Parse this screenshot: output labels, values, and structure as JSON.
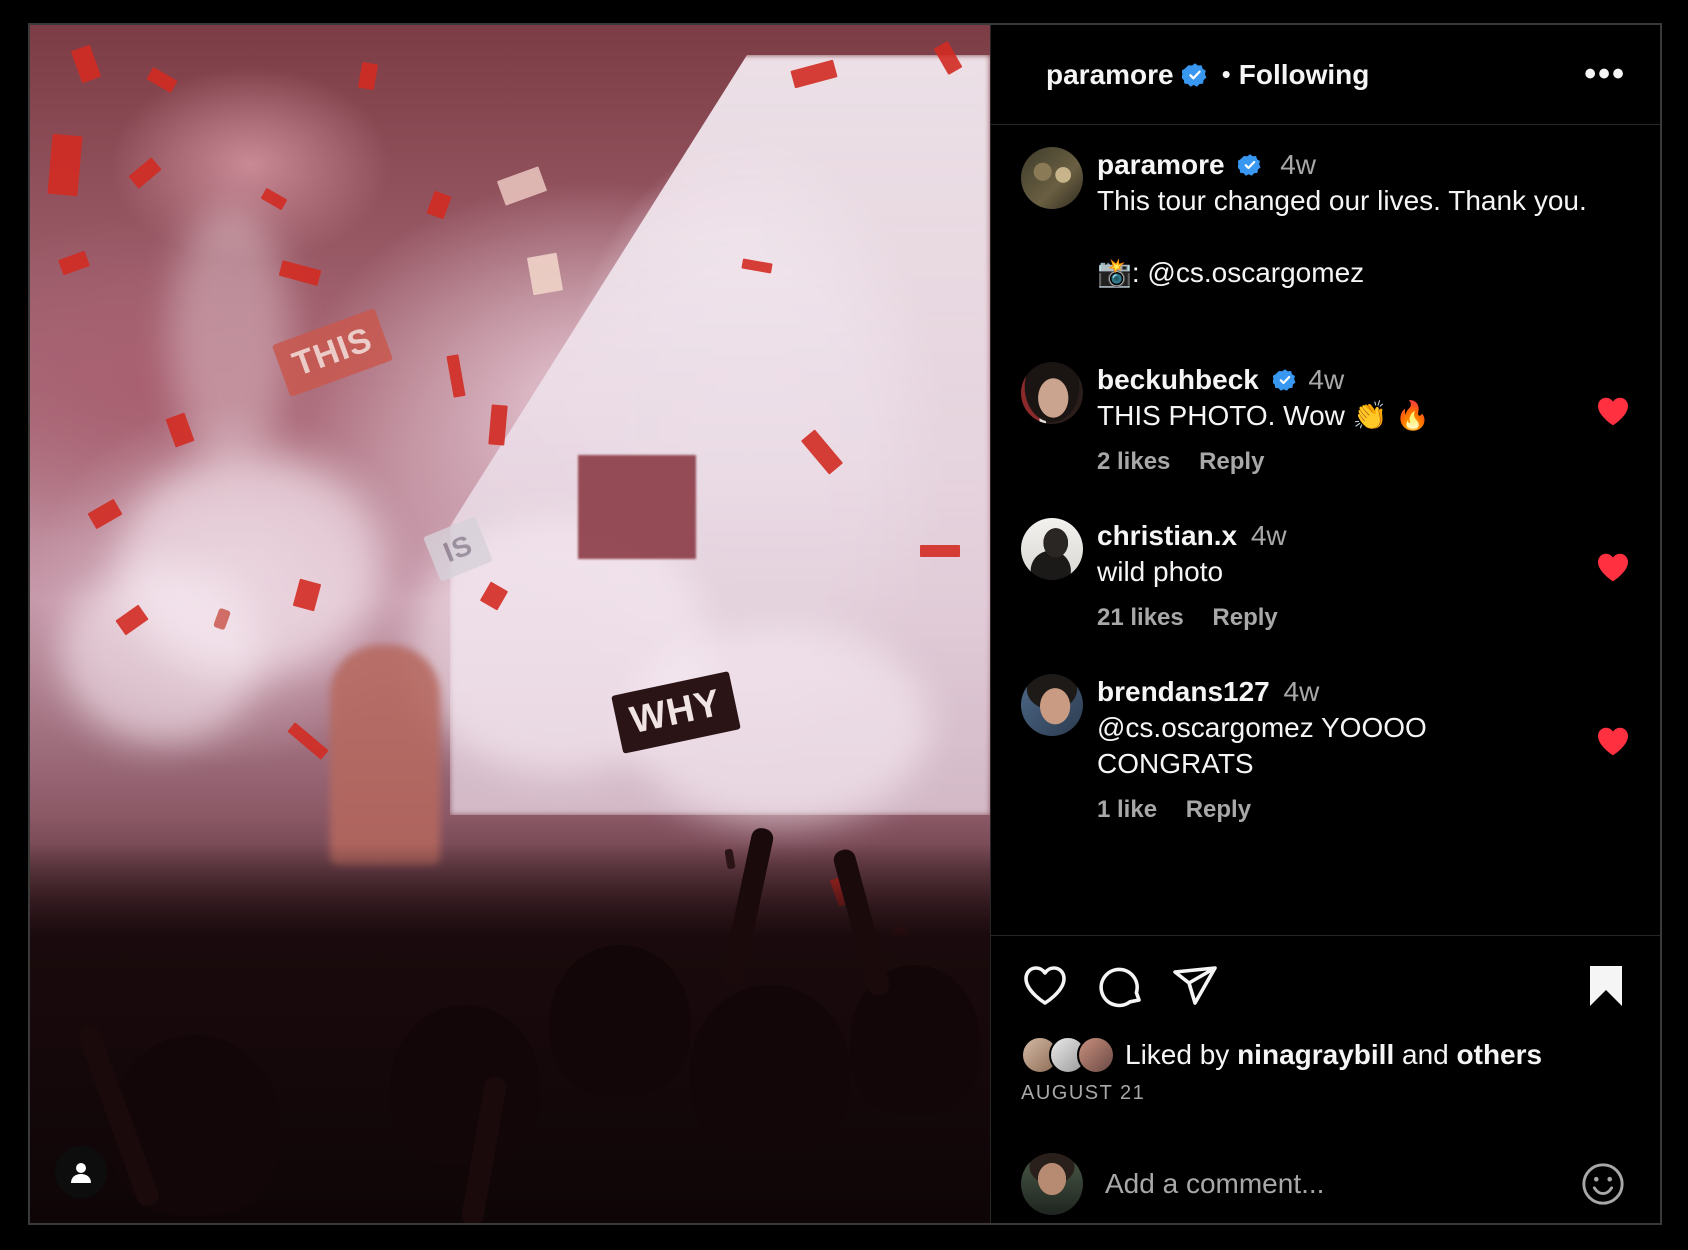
{
  "header": {
    "username": "paramore",
    "separator": "•",
    "follow_status": "Following",
    "more_label": "•••"
  },
  "caption": {
    "username": "paramore",
    "time": "4w",
    "text": "This tour changed our lives. Thank you.",
    "credit": "📸: @cs.oscargomez"
  },
  "comments": [
    {
      "username": "beckuhbeck",
      "verified": true,
      "time": "4w",
      "text": "THIS PHOTO. Wow 👏 🔥",
      "likes": "2 likes",
      "reply": "Reply",
      "liked": true
    },
    {
      "username": "christian.x",
      "verified": false,
      "time": "4w",
      "text": "wild photo",
      "likes": "21 likes",
      "reply": "Reply",
      "liked": true
    },
    {
      "username": "brendans127",
      "verified": false,
      "time": "4w",
      "text": "@cs.oscargomez YOOOO CONGRATS",
      "likes": "1 like",
      "reply": "Reply",
      "liked": true
    }
  ],
  "liked_by": {
    "prefix": "Liked by",
    "user": "ninagraybill",
    "and": "and",
    "others": "others"
  },
  "post_date": "AUGUST 21",
  "add_comment": {
    "placeholder": "Add a comment..."
  },
  "photo_signs": [
    "THIS",
    "IS",
    "WHY"
  ],
  "colors": {
    "verified": "#3897f0",
    "like_red": "#ff3040",
    "secondary_text": "#a8a8a8",
    "divider": "#262626"
  }
}
